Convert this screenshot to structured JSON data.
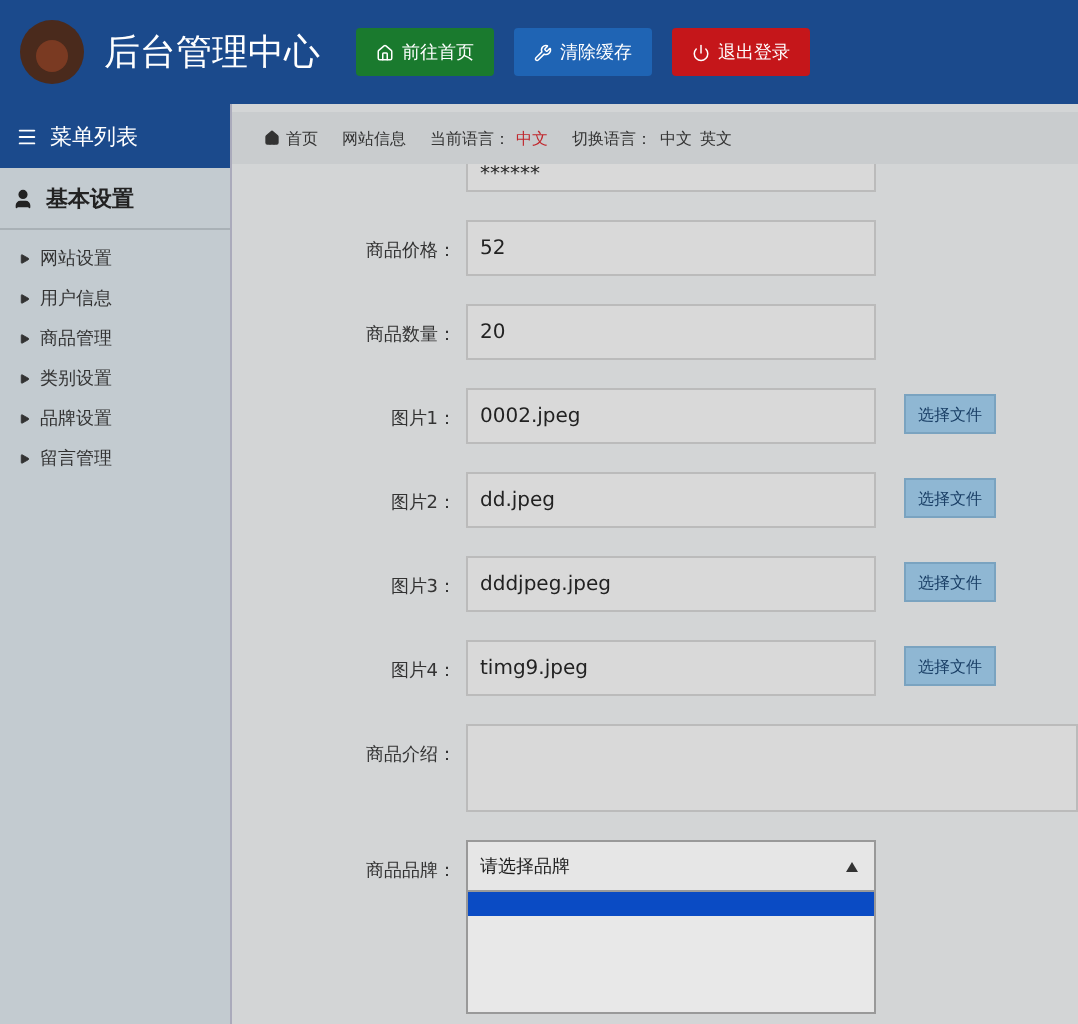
{
  "header": {
    "title": "后台管理中心",
    "buttons": [
      {
        "label": "前往首页",
        "kind": "home"
      },
      {
        "label": "清除缓存",
        "kind": "clear"
      },
      {
        "label": "退出登录",
        "kind": "logout"
      }
    ]
  },
  "sidebar": {
    "heading": "菜单列表",
    "section": "基本设置",
    "items": [
      "网站设置",
      "用户信息",
      "商品管理",
      "类别设置",
      "品牌设置",
      "留言管理"
    ]
  },
  "breadcrumb": {
    "home": "首页",
    "page": "网站信息",
    "language_label": "当前语言：",
    "language": "中文",
    "switch_label": "切换语言：",
    "switch_options": [
      "中文",
      "英文"
    ]
  },
  "form": {
    "top_field": {
      "value": "******"
    },
    "rows": [
      {
        "label": "商品价格：",
        "value": "52",
        "kind": "text"
      },
      {
        "label": "商品数量：",
        "value": "20",
        "kind": "text"
      },
      {
        "label": "图片1：",
        "value": "0002.jpeg",
        "kind": "file",
        "button": "选择文件"
      },
      {
        "label": "图片2：",
        "value": "dd.jpeg",
        "kind": "file",
        "button": "选择文件"
      },
      {
        "label": "图片3：",
        "value": "dddjpeg.jpeg",
        "kind": "file",
        "button": "选择文件"
      },
      {
        "label": "图片4：",
        "value": "timg9.jpeg",
        "kind": "file",
        "button": "选择文件"
      },
      {
        "label": "商品介绍：",
        "value": "",
        "kind": "textarea"
      },
      {
        "label": "商品品牌：",
        "value": "请选择品牌",
        "kind": "select",
        "expanded": true
      }
    ]
  }
}
